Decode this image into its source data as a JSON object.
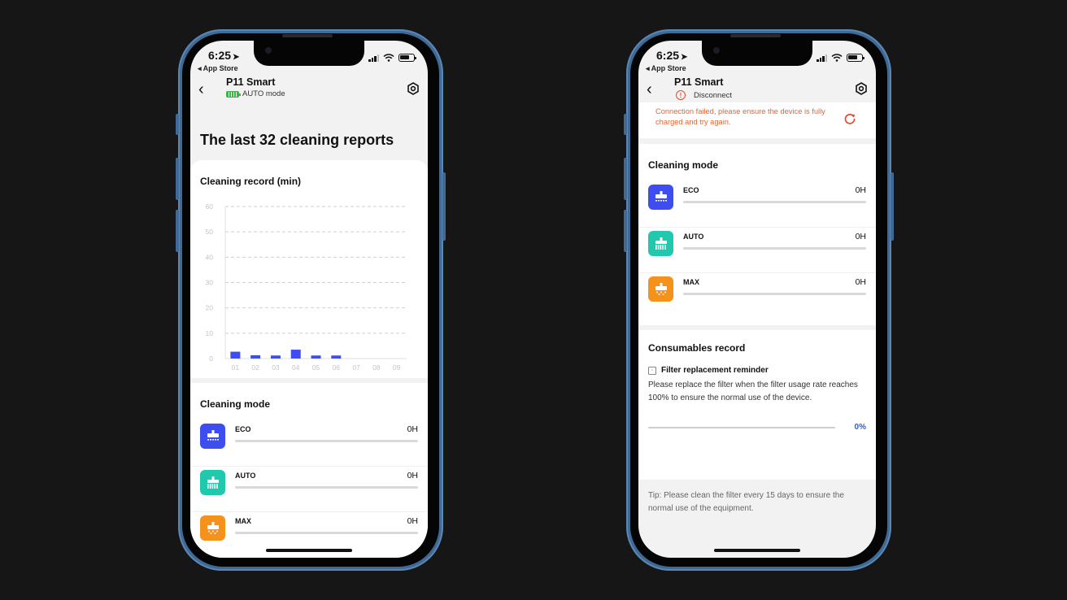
{
  "colors": {
    "eco": "#3d4df0",
    "auto": "#20c9ad",
    "max": "#f5921c",
    "bar": "#3d4df0",
    "alert": "#e9622f",
    "percent": "#2f5fc8"
  },
  "status_bar": {
    "time": "6:25",
    "location_icon": "location-arrow-icon",
    "back_app": "◂ App Store"
  },
  "left_phone": {
    "nav": {
      "title": "P11 Smart",
      "subtitle": "AUTO mode",
      "status_icon": "battery-full-icon",
      "settings_icon": "settings-icon"
    },
    "heading": "The last 32 cleaning reports",
    "chart_card": {
      "title": "Cleaning record (min)"
    },
    "cleaning_mode": {
      "title": "Cleaning mode",
      "modes": [
        {
          "name": "ECO",
          "value": "0H",
          "progress": 0
        },
        {
          "name": "AUTO",
          "value": "0H",
          "progress": 0
        },
        {
          "name": "MAX",
          "value": "0H",
          "progress": 0
        }
      ]
    }
  },
  "right_phone": {
    "nav": {
      "title": "P11 Smart",
      "subtitle": "Disconnect",
      "status_icon": "warning-icon",
      "settings_icon": "settings-icon"
    },
    "alert": {
      "message": "Connection failed, please ensure the device is fully charged and try again.",
      "action_icon": "refresh-icon"
    },
    "cleaning_mode": {
      "title": "Cleaning mode",
      "modes": [
        {
          "name": "ECO",
          "value": "0H",
          "progress": 0
        },
        {
          "name": "AUTO",
          "value": "0H",
          "progress": 0
        },
        {
          "name": "MAX",
          "value": "0H",
          "progress": 0
        }
      ]
    },
    "consumables": {
      "title": "Consumables record",
      "filter_title": "Filter replacement reminder",
      "filter_desc": "Please replace the filter when the filter usage rate reaches 100% to ensure the normal use of the device.",
      "filter_usage_label": "0%",
      "filter_usage": 0
    },
    "tip": "Tip: Please clean the filter every 15 days to ensure the normal use of the equipment."
  },
  "chart_data": {
    "type": "bar",
    "title": "Cleaning record (min)",
    "xlabel": "",
    "ylabel": "",
    "categories": [
      "01",
      "02",
      "03",
      "04",
      "05",
      "06",
      "07",
      "08",
      "09"
    ],
    "values": [
      2.7,
      1.3,
      1.2,
      3.5,
      1.2,
      1.2,
      0,
      0,
      0
    ],
    "yticks": [
      "0",
      "10",
      "20",
      "30",
      "40",
      "50",
      "60"
    ],
    "ylim": [
      0,
      60
    ],
    "grid": true,
    "legend": "none"
  }
}
